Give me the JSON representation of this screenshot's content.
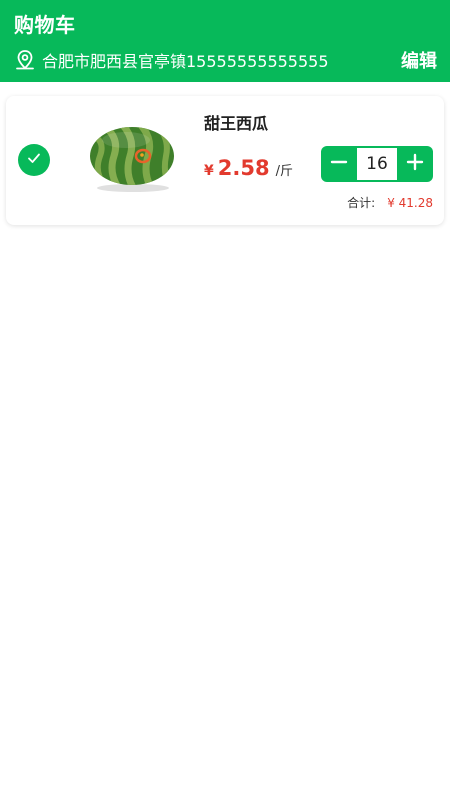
{
  "header": {
    "title": "购物车",
    "address": "合肥市肥西县官亭镇15555555555555",
    "address_icon": "location-pin-icon",
    "edit_label": "编辑",
    "background_color": "#07b95a"
  },
  "cart": {
    "items": [
      {
        "selected": true,
        "check_icon": "checkmark-icon",
        "image": "watermelon",
        "name": "甜王西瓜",
        "currency": "¥",
        "price": "2.58",
        "unit": "/斤",
        "quantity": "16",
        "subtotal_label": "合计:",
        "subtotal": "¥ 41.28"
      }
    ]
  },
  "colors": {
    "accent": "#07b95a",
    "price": "#e23a2e"
  }
}
